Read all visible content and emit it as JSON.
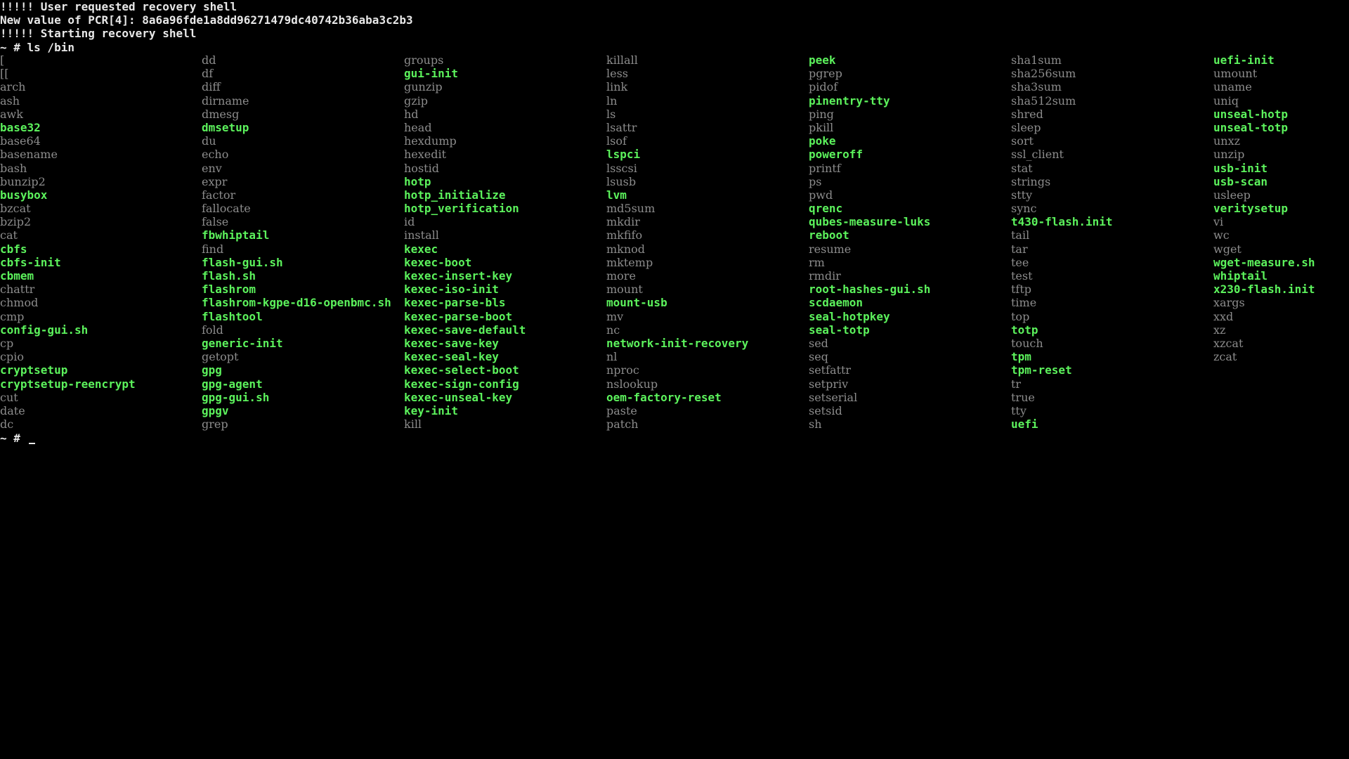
{
  "terminal": {
    "header_lines": [
      "!!!!! User requested recovery shell",
      "New value of PCR[4]: 8a6a96fde1a8dd96271479dc40742b36aba3c2b3",
      "!!!!! Starting recovery shell",
      "~ # ls /bin"
    ],
    "prompt": "~ # ",
    "colors": {
      "executable": "#5cf25c",
      "link": "#8c8c8c",
      "text": "#e8e8e8",
      "background": "#000000"
    }
  },
  "listing": {
    "columns": [
      [
        {
          "name": "[",
          "exec": false
        },
        {
          "name": "[[",
          "exec": false
        },
        {
          "name": "arch",
          "exec": false
        },
        {
          "name": "ash",
          "exec": false
        },
        {
          "name": "awk",
          "exec": false
        },
        {
          "name": "base32",
          "exec": true
        },
        {
          "name": "base64",
          "exec": false
        },
        {
          "name": "basename",
          "exec": false
        },
        {
          "name": "bash",
          "exec": false
        },
        {
          "name": "bunzip2",
          "exec": false
        },
        {
          "name": "busybox",
          "exec": true
        },
        {
          "name": "bzcat",
          "exec": false
        },
        {
          "name": "bzip2",
          "exec": false
        },
        {
          "name": "cat",
          "exec": false
        },
        {
          "name": "cbfs",
          "exec": true
        },
        {
          "name": "cbfs-init",
          "exec": true
        },
        {
          "name": "cbmem",
          "exec": true
        },
        {
          "name": "chattr",
          "exec": false
        },
        {
          "name": "chmod",
          "exec": false
        },
        {
          "name": "cmp",
          "exec": false
        },
        {
          "name": "config-gui.sh",
          "exec": true
        },
        {
          "name": "cp",
          "exec": false
        },
        {
          "name": "cpio",
          "exec": false
        },
        {
          "name": "cryptsetup",
          "exec": true
        },
        {
          "name": "cryptsetup-reencrypt",
          "exec": true
        },
        {
          "name": "cut",
          "exec": false
        },
        {
          "name": "date",
          "exec": false
        },
        {
          "name": "dc",
          "exec": false
        }
      ],
      [
        {
          "name": "dd",
          "exec": false
        },
        {
          "name": "df",
          "exec": false
        },
        {
          "name": "diff",
          "exec": false
        },
        {
          "name": "dirname",
          "exec": false
        },
        {
          "name": "dmesg",
          "exec": false
        },
        {
          "name": "dmsetup",
          "exec": true
        },
        {
          "name": "du",
          "exec": false
        },
        {
          "name": "echo",
          "exec": false
        },
        {
          "name": "env",
          "exec": false
        },
        {
          "name": "expr",
          "exec": false
        },
        {
          "name": "factor",
          "exec": false
        },
        {
          "name": "fallocate",
          "exec": false
        },
        {
          "name": "false",
          "exec": false
        },
        {
          "name": "fbwhiptail",
          "exec": true
        },
        {
          "name": "find",
          "exec": false
        },
        {
          "name": "flash-gui.sh",
          "exec": true
        },
        {
          "name": "flash.sh",
          "exec": true
        },
        {
          "name": "flashrom",
          "exec": true
        },
        {
          "name": "flashrom-kgpe-d16-openbmc.sh",
          "exec": true
        },
        {
          "name": "flashtool",
          "exec": true
        },
        {
          "name": "fold",
          "exec": false
        },
        {
          "name": "generic-init",
          "exec": true
        },
        {
          "name": "getopt",
          "exec": false
        },
        {
          "name": "gpg",
          "exec": true
        },
        {
          "name": "gpg-agent",
          "exec": true
        },
        {
          "name": "gpg-gui.sh",
          "exec": true
        },
        {
          "name": "gpgv",
          "exec": true
        },
        {
          "name": "grep",
          "exec": false
        }
      ],
      [
        {
          "name": "groups",
          "exec": false
        },
        {
          "name": "gui-init",
          "exec": true
        },
        {
          "name": "gunzip",
          "exec": false
        },
        {
          "name": "gzip",
          "exec": false
        },
        {
          "name": "hd",
          "exec": false
        },
        {
          "name": "head",
          "exec": false
        },
        {
          "name": "hexdump",
          "exec": false
        },
        {
          "name": "hexedit",
          "exec": false
        },
        {
          "name": "hostid",
          "exec": false
        },
        {
          "name": "hotp",
          "exec": true
        },
        {
          "name": "hotp_initialize",
          "exec": true
        },
        {
          "name": "hotp_verification",
          "exec": true
        },
        {
          "name": "id",
          "exec": false
        },
        {
          "name": "install",
          "exec": false
        },
        {
          "name": "kexec",
          "exec": true
        },
        {
          "name": "kexec-boot",
          "exec": true
        },
        {
          "name": "kexec-insert-key",
          "exec": true
        },
        {
          "name": "kexec-iso-init",
          "exec": true
        },
        {
          "name": "kexec-parse-bls",
          "exec": true
        },
        {
          "name": "kexec-parse-boot",
          "exec": true
        },
        {
          "name": "kexec-save-default",
          "exec": true
        },
        {
          "name": "kexec-save-key",
          "exec": true
        },
        {
          "name": "kexec-seal-key",
          "exec": true
        },
        {
          "name": "kexec-select-boot",
          "exec": true
        },
        {
          "name": "kexec-sign-config",
          "exec": true
        },
        {
          "name": "kexec-unseal-key",
          "exec": true
        },
        {
          "name": "key-init",
          "exec": true
        },
        {
          "name": "kill",
          "exec": false
        }
      ],
      [
        {
          "name": "killall",
          "exec": false
        },
        {
          "name": "less",
          "exec": false
        },
        {
          "name": "link",
          "exec": false
        },
        {
          "name": "ln",
          "exec": false
        },
        {
          "name": "ls",
          "exec": false
        },
        {
          "name": "lsattr",
          "exec": false
        },
        {
          "name": "lsof",
          "exec": false
        },
        {
          "name": "lspci",
          "exec": true
        },
        {
          "name": "lsscsi",
          "exec": false
        },
        {
          "name": "lsusb",
          "exec": false
        },
        {
          "name": "lvm",
          "exec": true
        },
        {
          "name": "md5sum",
          "exec": false
        },
        {
          "name": "mkdir",
          "exec": false
        },
        {
          "name": "mkfifo",
          "exec": false
        },
        {
          "name": "mknod",
          "exec": false
        },
        {
          "name": "mktemp",
          "exec": false
        },
        {
          "name": "more",
          "exec": false
        },
        {
          "name": "mount",
          "exec": false
        },
        {
          "name": "mount-usb",
          "exec": true
        },
        {
          "name": "mv",
          "exec": false
        },
        {
          "name": "nc",
          "exec": false
        },
        {
          "name": "network-init-recovery",
          "exec": true
        },
        {
          "name": "nl",
          "exec": false
        },
        {
          "name": "nproc",
          "exec": false
        },
        {
          "name": "nslookup",
          "exec": false
        },
        {
          "name": "oem-factory-reset",
          "exec": true
        },
        {
          "name": "paste",
          "exec": false
        },
        {
          "name": "patch",
          "exec": false
        }
      ],
      [
        {
          "name": "peek",
          "exec": true
        },
        {
          "name": "pgrep",
          "exec": false
        },
        {
          "name": "pidof",
          "exec": false
        },
        {
          "name": "pinentry-tty",
          "exec": true
        },
        {
          "name": "ping",
          "exec": false
        },
        {
          "name": "pkill",
          "exec": false
        },
        {
          "name": "poke",
          "exec": true
        },
        {
          "name": "poweroff",
          "exec": true
        },
        {
          "name": "printf",
          "exec": false
        },
        {
          "name": "ps",
          "exec": false
        },
        {
          "name": "pwd",
          "exec": false
        },
        {
          "name": "qrenc",
          "exec": true
        },
        {
          "name": "qubes-measure-luks",
          "exec": true
        },
        {
          "name": "reboot",
          "exec": true
        },
        {
          "name": "resume",
          "exec": false
        },
        {
          "name": "rm",
          "exec": false
        },
        {
          "name": "rmdir",
          "exec": false
        },
        {
          "name": "root-hashes-gui.sh",
          "exec": true
        },
        {
          "name": "scdaemon",
          "exec": true
        },
        {
          "name": "seal-hotpkey",
          "exec": true
        },
        {
          "name": "seal-totp",
          "exec": true
        },
        {
          "name": "sed",
          "exec": false
        },
        {
          "name": "seq",
          "exec": false
        },
        {
          "name": "setfattr",
          "exec": false
        },
        {
          "name": "setpriv",
          "exec": false
        },
        {
          "name": "setserial",
          "exec": false
        },
        {
          "name": "setsid",
          "exec": false
        },
        {
          "name": "sh",
          "exec": false
        }
      ],
      [
        {
          "name": "sha1sum",
          "exec": false
        },
        {
          "name": "sha256sum",
          "exec": false
        },
        {
          "name": "sha3sum",
          "exec": false
        },
        {
          "name": "sha512sum",
          "exec": false
        },
        {
          "name": "shred",
          "exec": false
        },
        {
          "name": "sleep",
          "exec": false
        },
        {
          "name": "sort",
          "exec": false
        },
        {
          "name": "ssl_client",
          "exec": false
        },
        {
          "name": "stat",
          "exec": false
        },
        {
          "name": "strings",
          "exec": false
        },
        {
          "name": "stty",
          "exec": false
        },
        {
          "name": "sync",
          "exec": false
        },
        {
          "name": "t430-flash.init",
          "exec": true
        },
        {
          "name": "tail",
          "exec": false
        },
        {
          "name": "tar",
          "exec": false
        },
        {
          "name": "tee",
          "exec": false
        },
        {
          "name": "test",
          "exec": false
        },
        {
          "name": "tftp",
          "exec": false
        },
        {
          "name": "time",
          "exec": false
        },
        {
          "name": "top",
          "exec": false
        },
        {
          "name": "totp",
          "exec": true
        },
        {
          "name": "touch",
          "exec": false
        },
        {
          "name": "tpm",
          "exec": true
        },
        {
          "name": "tpm-reset",
          "exec": true
        },
        {
          "name": "tr",
          "exec": false
        },
        {
          "name": "true",
          "exec": false
        },
        {
          "name": "tty",
          "exec": false
        },
        {
          "name": "uefi",
          "exec": true
        }
      ],
      [
        {
          "name": "uefi-init",
          "exec": true
        },
        {
          "name": "umount",
          "exec": false
        },
        {
          "name": "uname",
          "exec": false
        },
        {
          "name": "uniq",
          "exec": false
        },
        {
          "name": "unseal-hotp",
          "exec": true
        },
        {
          "name": "unseal-totp",
          "exec": true
        },
        {
          "name": "unxz",
          "exec": false
        },
        {
          "name": "unzip",
          "exec": false
        },
        {
          "name": "usb-init",
          "exec": true
        },
        {
          "name": "usb-scan",
          "exec": true
        },
        {
          "name": "usleep",
          "exec": false
        },
        {
          "name": "veritysetup",
          "exec": true
        },
        {
          "name": "vi",
          "exec": false
        },
        {
          "name": "wc",
          "exec": false
        },
        {
          "name": "wget",
          "exec": false
        },
        {
          "name": "wget-measure.sh",
          "exec": true
        },
        {
          "name": "whiptail",
          "exec": true
        },
        {
          "name": "x230-flash.init",
          "exec": true
        },
        {
          "name": "xargs",
          "exec": false
        },
        {
          "name": "xxd",
          "exec": false
        },
        {
          "name": "xz",
          "exec": false
        },
        {
          "name": "xzcat",
          "exec": false
        },
        {
          "name": "zcat",
          "exec": false
        }
      ]
    ]
  }
}
